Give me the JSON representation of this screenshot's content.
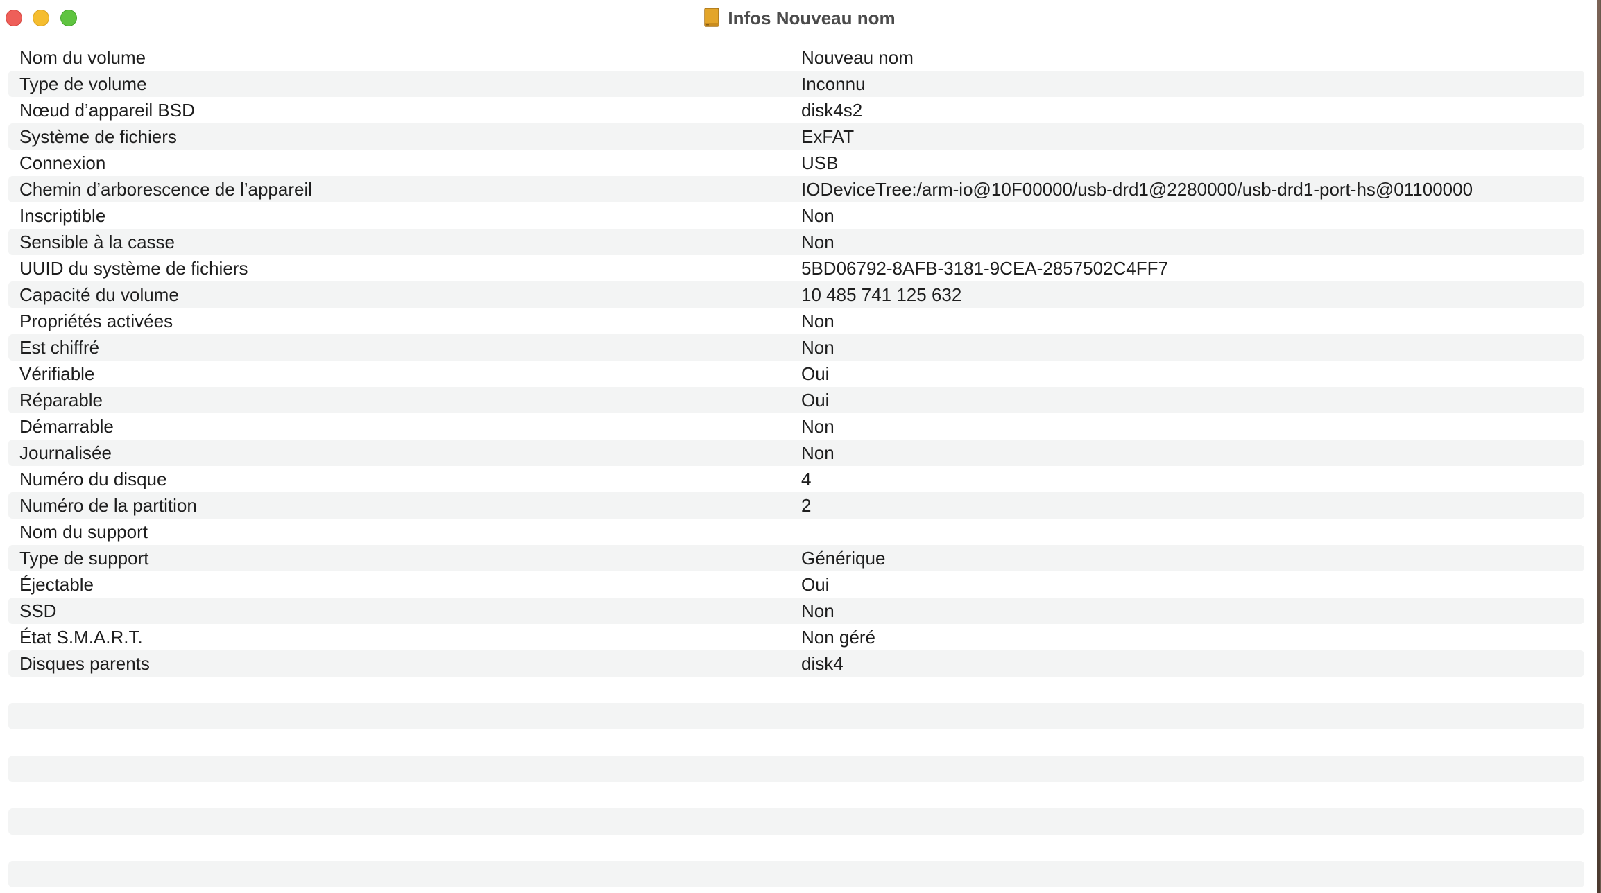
{
  "window": {
    "title": "Infos Nouveau nom",
    "icon": "external-drive-icon"
  },
  "info_rows": [
    {
      "label": "Nom du volume",
      "value": "Nouveau nom"
    },
    {
      "label": "Type de volume",
      "value": "Inconnu"
    },
    {
      "label": "Nœud d’appareil BSD",
      "value": "disk4s2"
    },
    {
      "label": "Système de fichiers",
      "value": "ExFAT"
    },
    {
      "label": "Connexion",
      "value": "USB"
    },
    {
      "label": "Chemin d’arborescence de l’appareil",
      "value": "IODeviceTree:/arm-io@10F00000/usb-drd1@2280000/usb-drd1-port-hs@01100000"
    },
    {
      "label": "Inscriptible",
      "value": "Non"
    },
    {
      "label": "Sensible à la casse",
      "value": "Non"
    },
    {
      "label": "UUID du système de fichiers",
      "value": "5BD06792-8AFB-3181-9CEA-2857502C4FF7"
    },
    {
      "label": "Capacité du volume",
      "value": "10 485 741 125 632"
    },
    {
      "label": "Propriétés activées",
      "value": "Non"
    },
    {
      "label": "Est chiffré",
      "value": "Non"
    },
    {
      "label": "Vérifiable",
      "value": "Oui"
    },
    {
      "label": "Réparable",
      "value": "Oui"
    },
    {
      "label": "Démarrable",
      "value": "Non"
    },
    {
      "label": "Journalisée",
      "value": "Non"
    },
    {
      "label": "Numéro du disque",
      "value": "4"
    },
    {
      "label": "Numéro de la partition",
      "value": "2"
    },
    {
      "label": "Nom du support",
      "value": ""
    },
    {
      "label": "Type de support",
      "value": "Générique"
    },
    {
      "label": "Éjectable",
      "value": "Oui"
    },
    {
      "label": "SSD",
      "value": "Non"
    },
    {
      "label": "État S.M.A.R.T.",
      "value": "Non géré"
    },
    {
      "label": "Disques parents",
      "value": "disk4"
    }
  ],
  "colors": {
    "row_stripe": "#f3f4f4",
    "close": "#ee5f59",
    "minimize": "#f5bd2f",
    "zoom": "#5fc440"
  }
}
